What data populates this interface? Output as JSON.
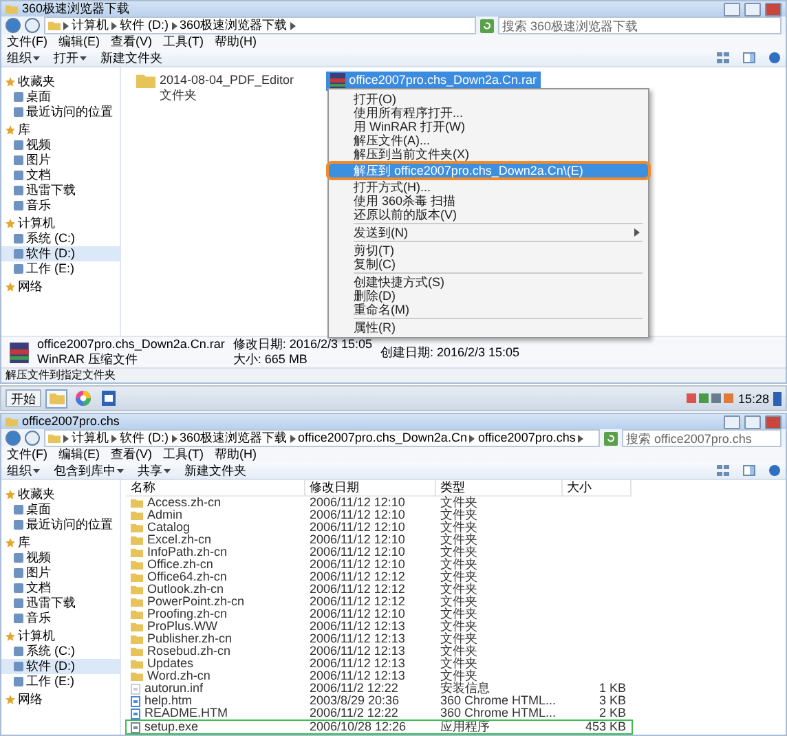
{
  "top_window": {
    "title": "360极速浏览器下载",
    "address": [
      "计算机",
      "软件 (D:)",
      "360极速浏览器下载"
    ],
    "search": {
      "placeholder": "搜索 360极速浏览器下载"
    },
    "menu": [
      "文件(F)",
      "编辑(E)",
      "查看(V)",
      "工具(T)",
      "帮助(H)"
    ],
    "toolbar": [
      {
        "label": "组织",
        "dropdown": true
      },
      {
        "label": "打开",
        "dropdown": true
      },
      {
        "label": "新建文件夹",
        "dropdown": false
      }
    ],
    "sidebar": [
      {
        "label": "收藏夹",
        "kind": "group",
        "selected": false
      },
      {
        "label": "桌面",
        "kind": "item",
        "selected": false
      },
      {
        "label": "最近访问的位置",
        "kind": "item",
        "selected": false
      },
      {
        "label": "库",
        "kind": "group",
        "selected": false
      },
      {
        "label": "视频",
        "kind": "item",
        "selected": false
      },
      {
        "label": "图片",
        "kind": "item",
        "selected": false
      },
      {
        "label": "文档",
        "kind": "item",
        "selected": false
      },
      {
        "label": "迅雷下载",
        "kind": "item",
        "selected": false
      },
      {
        "label": "音乐",
        "kind": "item",
        "selected": false
      },
      {
        "label": "计算机",
        "kind": "group",
        "selected": false
      },
      {
        "label": "系统 (C:)",
        "kind": "item",
        "selected": false
      },
      {
        "label": "软件 (D:)",
        "kind": "item",
        "selected": true
      },
      {
        "label": "工作 (E:)",
        "kind": "item",
        "selected": false
      },
      {
        "label": "网络",
        "kind": "group",
        "selected": false
      }
    ],
    "files": [
      {
        "name": "2014-08-04_PDF_Editor",
        "type": "文件夹",
        "kind": "folder",
        "selected": false
      },
      {
        "name": "office2007pro.chs_Down2a.Cn.rar",
        "kind": "archive",
        "selected": true
      }
    ],
    "context_menu": [
      {
        "kind": "item",
        "label": "打开(O)",
        "highlighted": false,
        "annotated": false
      },
      {
        "kind": "item",
        "label": "使用所有程序打开...",
        "highlighted": false,
        "annotated": false
      },
      {
        "kind": "item",
        "label": "用 WinRAR 打开(W)",
        "highlighted": false,
        "annotated": false
      },
      {
        "kind": "item",
        "label": "解压文件(A)...",
        "highlighted": false,
        "annotated": false
      },
      {
        "kind": "item",
        "label": "解压到当前文件夹(X)",
        "highlighted": false,
        "annotated": false
      },
      {
        "kind": "item",
        "label": "解压到 office2007pro.chs_Down2a.Cn\\(E)",
        "highlighted": true,
        "annotated": true
      },
      {
        "kind": "item",
        "label": "打开方式(H)...",
        "highlighted": false,
        "annotated": false
      },
      {
        "kind": "item",
        "label": "使用 360杀毒 扫描",
        "highlighted": false,
        "annotated": false
      },
      {
        "kind": "item",
        "label": "还原以前的版本(V)",
        "highlighted": false,
        "annotated": false
      },
      {
        "kind": "separator"
      },
      {
        "kind": "submenu",
        "label": "发送到(N)",
        "highlighted": false,
        "annotated": false
      },
      {
        "kind": "separator"
      },
      {
        "kind": "item",
        "label": "剪切(T)",
        "highlighted": false,
        "annotated": false
      },
      {
        "kind": "item",
        "label": "复制(C)",
        "highlighted": false,
        "annotated": false
      },
      {
        "kind": "separator"
      },
      {
        "kind": "item",
        "label": "创建快捷方式(S)",
        "highlighted": false,
        "annotated": false
      },
      {
        "kind": "item",
        "label": "删除(D)",
        "highlighted": false,
        "annotated": false
      },
      {
        "kind": "item",
        "label": "重命名(M)",
        "highlighted": false,
        "annotated": false
      },
      {
        "kind": "separator"
      },
      {
        "kind": "item",
        "label": "属性(R)",
        "highlighted": false,
        "annotated": false
      }
    ],
    "details": {
      "name": "office2007pro.chs_Down2a.Cn.rar",
      "type": "WinRAR 压缩文件",
      "modified": "修改日期: 2016/2/3 15:05",
      "size": "大小: 665 MB",
      "created": "创建日期: 2016/2/3 15:05"
    },
    "status": "解压文件到指定文件夹"
  },
  "taskbar": {
    "start": "开始",
    "apps": [
      {
        "kind": "folder",
        "selected": true
      },
      {
        "kind": "browser",
        "selected": false
      },
      {
        "kind": "document",
        "selected": false
      }
    ],
    "clock": "15:28"
  },
  "bottom_window": {
    "title": "office2007pro.chs",
    "address": [
      "计算机",
      "软件 (D:)",
      "360极速浏览器下载",
      "office2007pro.chs_Down2a.Cn",
      "office2007pro.chs"
    ],
    "search": {
      "placeholder": "搜索 office2007pro.chs"
    },
    "menu": [
      "文件(F)",
      "编辑(E)",
      "查看(V)",
      "工具(T)",
      "帮助(H)"
    ],
    "toolbar": [
      {
        "label": "组织",
        "dropdown": true
      },
      {
        "label": "包含到库中",
        "dropdown": true
      },
      {
        "label": "共享",
        "dropdown": true
      },
      {
        "label": "新建文件夹",
        "dropdown": false
      }
    ],
    "sidebar": [
      {
        "label": "收藏夹",
        "kind": "group",
        "selected": false
      },
      {
        "label": "桌面",
        "kind": "item",
        "selected": false
      },
      {
        "label": "最近访问的位置",
        "kind": "item",
        "selected": false
      },
      {
        "label": "库",
        "kind": "group",
        "selected": false
      },
      {
        "label": "视频",
        "kind": "item",
        "selected": false
      },
      {
        "label": "图片",
        "kind": "item",
        "selected": false
      },
      {
        "label": "文档",
        "kind": "item",
        "selected": false
      },
      {
        "label": "迅雷下载",
        "kind": "item",
        "selected": false
      },
      {
        "label": "音乐",
        "kind": "item",
        "selected": false
      },
      {
        "label": "计算机",
        "kind": "group",
        "selected": false
      },
      {
        "label": "系统 (C:)",
        "kind": "item",
        "selected": false
      },
      {
        "label": "软件 (D:)",
        "kind": "item",
        "selected": true
      },
      {
        "label": "工作 (E:)",
        "kind": "item",
        "selected": false
      },
      {
        "label": "网络",
        "kind": "group",
        "selected": false
      }
    ],
    "columns": [
      "名称",
      "修改日期",
      "类型",
      "大小"
    ],
    "rows": [
      {
        "name": "Access.zh-cn",
        "date": "2006/11/12 12:10",
        "type": "文件夹",
        "kind": "folder",
        "annotated": false
      },
      {
        "name": "Admin",
        "date": "2006/11/12 12:10",
        "type": "文件夹",
        "kind": "folder",
        "annotated": false
      },
      {
        "name": "Catalog",
        "date": "2006/11/12 12:10",
        "type": "文件夹",
        "kind": "folder",
        "annotated": false
      },
      {
        "name": "Excel.zh-cn",
        "date": "2006/11/12 12:10",
        "type": "文件夹",
        "kind": "folder",
        "annotated": false
      },
      {
        "name": "InfoPath.zh-cn",
        "date": "2006/11/12 12:10",
        "type": "文件夹",
        "kind": "folder",
        "annotated": false
      },
      {
        "name": "Office.zh-cn",
        "date": "2006/11/12 12:10",
        "type": "文件夹",
        "kind": "folder",
        "annotated": false
      },
      {
        "name": "Office64.zh-cn",
        "date": "2006/11/12 12:12",
        "type": "文件夹",
        "kind": "folder",
        "annotated": false
      },
      {
        "name": "Outlook.zh-cn",
        "date": "2006/11/12 12:12",
        "type": "文件夹",
        "kind": "folder",
        "annotated": false
      },
      {
        "name": "PowerPoint.zh-cn",
        "date": "2006/11/12 12:12",
        "type": "文件夹",
        "kind": "folder",
        "annotated": false
      },
      {
        "name": "Proofing.zh-cn",
        "date": "2006/11/12 12:10",
        "type": "文件夹",
        "kind": "folder",
        "annotated": false
      },
      {
        "name": "ProPlus.WW",
        "date": "2006/11/12 12:13",
        "type": "文件夹",
        "kind": "folder",
        "annotated": false
      },
      {
        "name": "Publisher.zh-cn",
        "date": "2006/11/12 12:13",
        "type": "文件夹",
        "kind": "folder",
        "annotated": false
      },
      {
        "name": "Rosebud.zh-cn",
        "date": "2006/11/12 12:13",
        "type": "文件夹",
        "kind": "folder",
        "annotated": false
      },
      {
        "name": "Updates",
        "date": "2006/11/12 12:13",
        "type": "文件夹",
        "kind": "folder",
        "annotated": false
      },
      {
        "name": "Word.zh-cn",
        "date": "2006/11/12 12:13",
        "type": "文件夹",
        "kind": "folder",
        "annotated": false
      },
      {
        "name": "autorun.inf",
        "date": "2006/11/2 12:22",
        "type": "安装信息",
        "size": "1 KB",
        "kind": "file",
        "annotated": false
      },
      {
        "name": "help.htm",
        "date": "2003/8/29 20:36",
        "type": "360 Chrome HTML...",
        "size": "3 KB",
        "kind": "web",
        "annotated": false
      },
      {
        "name": "README.HTM",
        "date": "2006/11/2 12:22",
        "type": "360 Chrome HTML...",
        "size": "2 KB",
        "kind": "web",
        "annotated": false
      },
      {
        "name": "setup.exe",
        "date": "2006/10/28 12:26",
        "type": "应用程序",
        "size": "453 KB",
        "kind": "program",
        "annotated": true
      }
    ]
  }
}
